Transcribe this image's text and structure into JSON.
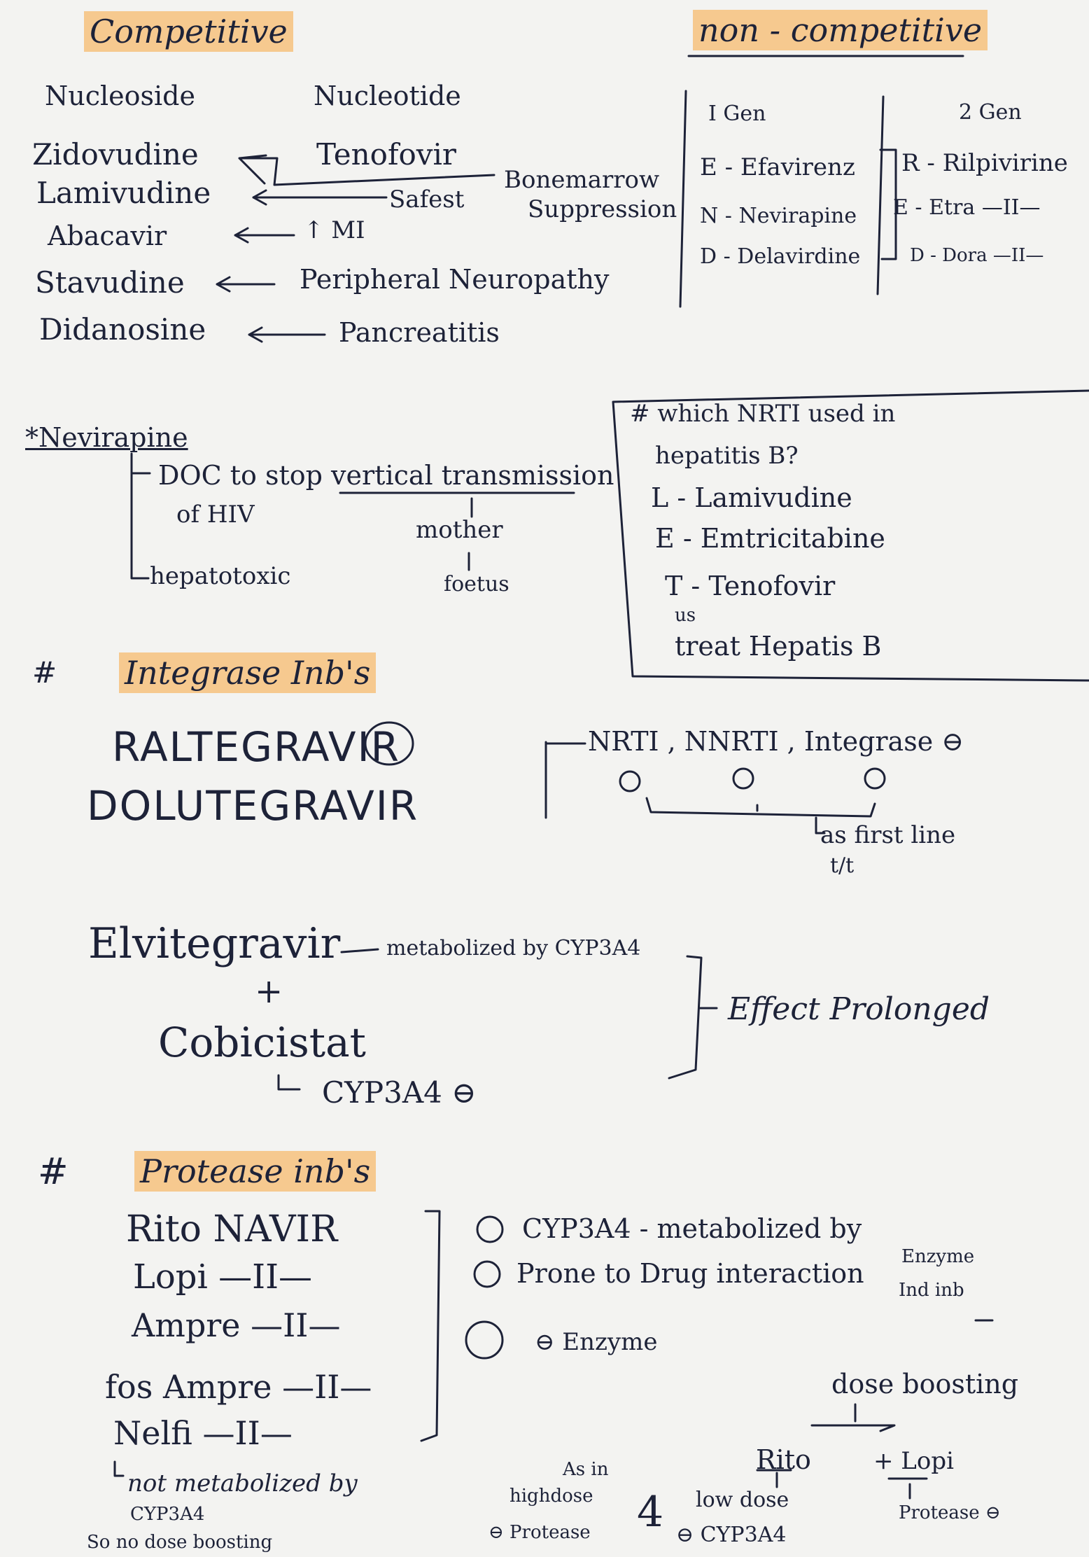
{
  "competitive": {
    "title": "Competitive",
    "nucleoside_header": "Nucleoside",
    "nucleotide_header": "Nucleotide",
    "drugs": [
      "Zidovudine",
      "Lamivudine",
      "Abacavir",
      "Stavudine",
      "Didanosine"
    ],
    "tenofovir": "Tenofovir",
    "safest": "Safest",
    "mi": "↑ MI",
    "bone_marrow": "Bonemarrow",
    "suppression": "Suppression",
    "peripheral": "Peripheral Neuropathy",
    "pancreatitis": "Pancreatitis"
  },
  "non_competitive": {
    "title": "non - competitive",
    "gen1_header": "I Gen",
    "gen1": [
      "E - Efavirenz",
      "N - Nevirapine",
      "D - Delavirdine"
    ],
    "gen2_header": "2 Gen",
    "gen2": [
      "R - Rilpivirine",
      "E - Etra —II—",
      "D - Dora —II—"
    ]
  },
  "nevirapine": {
    "title": "*Nevirapine",
    "doc_line1": "DOC to stop vertical transmission",
    "doc_line2": "of HIV",
    "mother": "mother",
    "foetus": "foetus",
    "hepato": "hepatotoxic"
  },
  "hep_b_box": {
    "q1": "# which NRTI used in",
    "q2": "hepatitis B?",
    "items": [
      "L - Lamivudine",
      "E - Emtricitabine",
      "T - Tenofovir"
    ],
    "us": "us",
    "treat": "treat Hepatis B"
  },
  "integrase": {
    "hash": "#",
    "title": "Integrase Inb's",
    "drug1": "RALTEGRAVIR",
    "drug2": "DOLUTEGRAVIR",
    "line_label": "NRTI , NNRTI , Integrase ⊖",
    "first_line": "as first line",
    "tlt": "t/t",
    "elvi": "Elvitegravir",
    "metab": "metabolized by CYP3A4",
    "plus": "+",
    "cobi": "Cobicistat",
    "cyp": "CYP3A4 ⊖",
    "effect": "Effect Prolonged"
  },
  "protease": {
    "hash": "#",
    "title": "Protease inb's",
    "drugs": [
      "Rito NAVIR",
      "Lopi —II—",
      "Ampre —II—",
      "fos Ampre —II—",
      "Nelfi —II—"
    ],
    "note1": "not metabolized by",
    "note2": "CYP3A4",
    "note3": "So no dose boosting",
    "point1": "CYP3A4 - metabolized by",
    "point2": "Prone to Drug interaction",
    "enzyme_note": "Enzyme",
    "ind_inb": "Ind inb",
    "point3": "⊖ Enzyme",
    "dose_boosting": "dose boosting",
    "ritro": "Rito",
    "lopi": "+ Lopi",
    "protease_inb": "Protease ⊖",
    "as_in": "As in",
    "highdose": "highdose",
    "protease_minus": "⊖ Protease",
    "four": "4",
    "low_dose": "low dose",
    "cyp_minus": "⊖ CYP3A4"
  }
}
